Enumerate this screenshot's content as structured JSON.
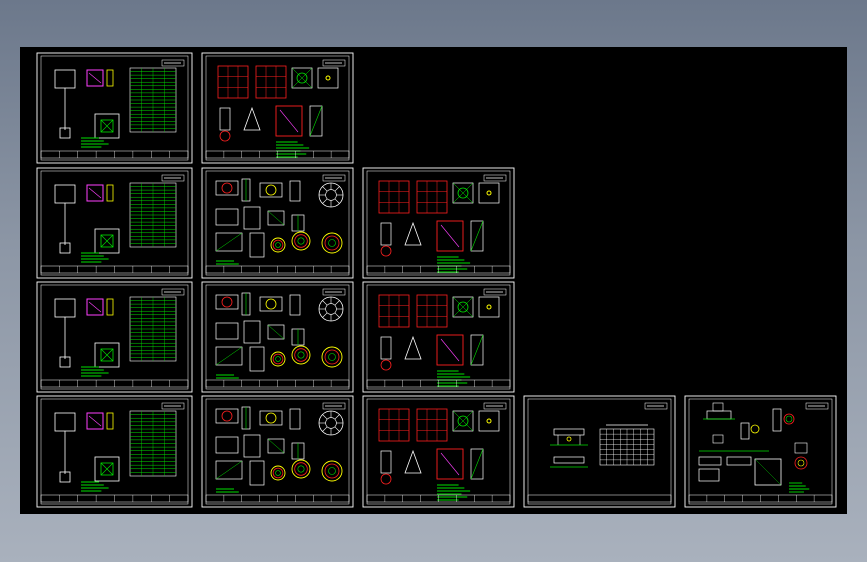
{
  "viewer": {
    "background_color": "#000000",
    "frame_color": "#ffffff",
    "line_colors": [
      "#00e000",
      "#ffffff",
      "#ff2020",
      "#ff40ff",
      "#00ffff",
      "#ffff00"
    ]
  },
  "sheets": [
    {
      "id": "s1",
      "type": "elevation"
    },
    {
      "id": "s2",
      "type": "detail-red"
    },
    {
      "id": "s3",
      "type": "elevation"
    },
    {
      "id": "s4",
      "type": "details"
    },
    {
      "id": "s5",
      "type": "detail-red"
    },
    {
      "id": "s6",
      "type": "elevation"
    },
    {
      "id": "s7",
      "type": "details"
    },
    {
      "id": "s8",
      "type": "detail-red"
    },
    {
      "id": "s9",
      "type": "elevation"
    },
    {
      "id": "s10",
      "type": "details"
    },
    {
      "id": "s11",
      "type": "detail-red"
    },
    {
      "id": "s12",
      "type": "table"
    },
    {
      "id": "s13",
      "type": "sections"
    }
  ]
}
